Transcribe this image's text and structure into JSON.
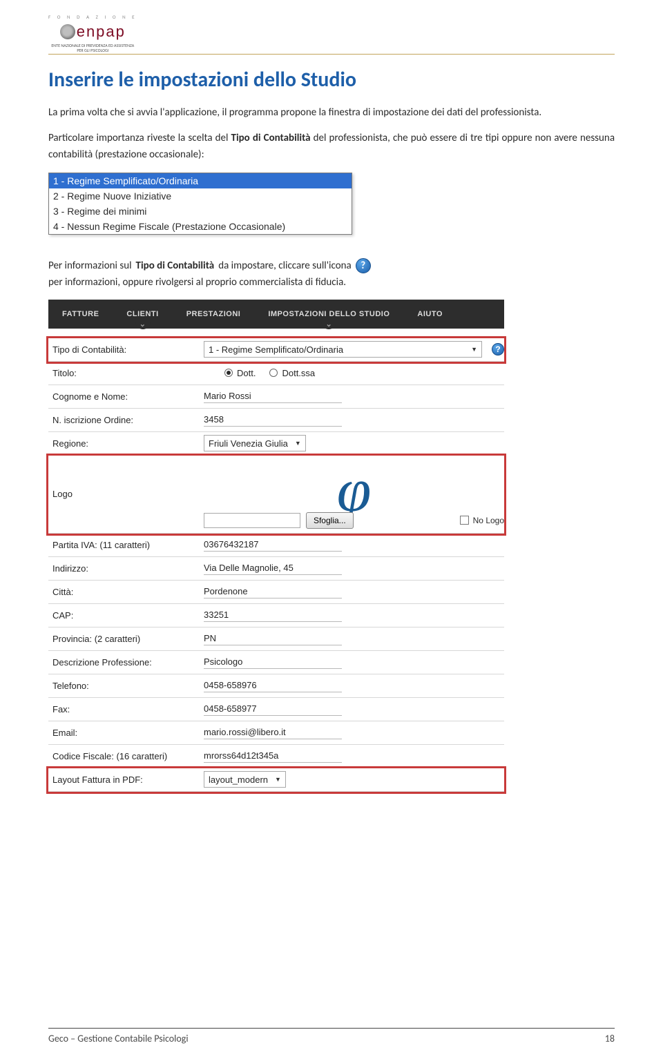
{
  "header_logo": {
    "top_small": "F O N D A Z I O N E",
    "brand": "enpap",
    "tagline": "ENTE NAZIONALE DI PREVIDENZA ED ASSISTENZA PER GLI PSICOLOGI"
  },
  "heading": "Inserire le impostazioni dello Studio",
  "para1": "La prima volta che si avvia l'applicazione, il programma propone la finestra di impostazione dei dati del professionista.",
  "para2_a": "Particolare importanza riveste la scelta del ",
  "para2_bold": "Tipo di Contabilità",
  "para2_b": " del professionista, che può essere di tre tipi oppure non avere nessuna contabilità (prestazione occasionale):",
  "regimes": [
    "1 - Regime Semplificato/Ordinaria",
    "2 - Regime Nuove Iniziative",
    "3 - Regime dei minimi",
    "4 - Nessun Regime Fiscale (Prestazione Occasionale)"
  ],
  "para3_a": "Per informazioni sul ",
  "para3_bold": "Tipo di Contabilità",
  "para3_b": " da impostare, cliccare sull'icona ",
  "para3_c": " per informazioni, oppure rivolgersi al proprio commercialista di fiducia.",
  "nav": [
    "FATTURE",
    "CLIENTI",
    "PRESTAZIONI",
    "IMPOSTAZIONI DELLO STUDIO",
    "AIUTO"
  ],
  "form": {
    "tipo_contabilita": {
      "label": "Tipo di Contabilità:",
      "value": "1 - Regime Semplificato/Ordinaria"
    },
    "titolo": {
      "label": "Titolo:",
      "opt1": "Dott.",
      "opt2": "Dott.ssa"
    },
    "nome": {
      "label": "Cognome e Nome:",
      "value": "Mario Rossi"
    },
    "n_iscrizione": {
      "label": "N. iscrizione Ordine:",
      "value": "3458"
    },
    "regione": {
      "label": "Regione:",
      "value": "Friuli Venezia Giulia"
    },
    "logo": {
      "label": "Logo",
      "sfoglia": "Sfoglia...",
      "nologo": "No Logo"
    },
    "piva": {
      "label": "Partita IVA: (11 caratteri)",
      "value": "03676432187"
    },
    "indirizzo": {
      "label": "Indirizzo:",
      "value": "Via Delle Magnolie, 45"
    },
    "citta": {
      "label": "Città:",
      "value": "Pordenone"
    },
    "cap": {
      "label": "CAP:",
      "value": "33251"
    },
    "provincia": {
      "label": "Provincia: (2 caratteri)",
      "value": "PN"
    },
    "descr_prof": {
      "label": "Descrizione Professione:",
      "value": "Psicologo"
    },
    "telefono": {
      "label": "Telefono:",
      "value": "0458-658976"
    },
    "fax": {
      "label": "Fax:",
      "value": "0458-658977"
    },
    "email": {
      "label": "Email:",
      "value": "mario.rossi@libero.it"
    },
    "cf": {
      "label": "Codice Fiscale: (16 caratteri)",
      "value": "mrorss64d12t345a"
    },
    "layout": {
      "label": "Layout Fattura in PDF:",
      "value": "layout_modern"
    }
  },
  "footer": {
    "left": "Geco – Gestione Contabile Psicologi",
    "right": "18"
  }
}
